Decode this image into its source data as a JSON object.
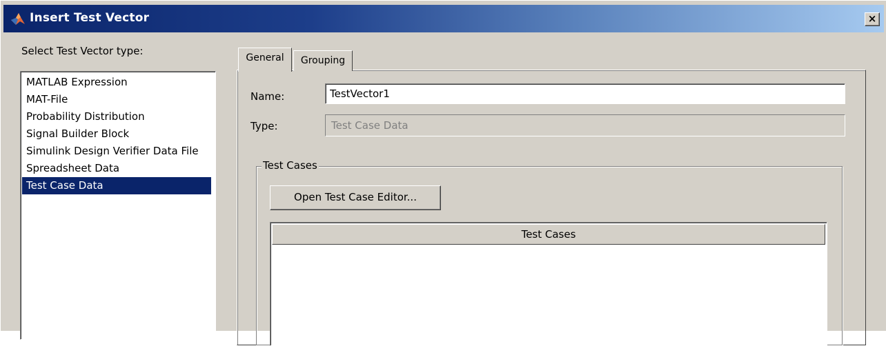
{
  "window": {
    "title": "Insert Test Vector",
    "close_label": "×"
  },
  "left": {
    "label": "Select Test Vector type:",
    "items": [
      "MATLAB Expression",
      "MAT-File",
      "Probability Distribution",
      "Signal Builder Block",
      "Simulink Design Verifier Data File",
      "Spreadsheet Data",
      "Test Case Data"
    ],
    "selected_index": 6
  },
  "tabs": [
    {
      "label": "General",
      "active": true
    },
    {
      "label": "Grouping",
      "active": false
    }
  ],
  "general": {
    "name_label": "Name:",
    "name_value": "TestVector1",
    "type_label": "Type:",
    "type_value": "Test Case Data"
  },
  "test_cases": {
    "group_title": "Test Cases",
    "open_button": "Open Test Case Editor...",
    "column_header": "Test Cases"
  },
  "colors": {
    "selection": "#0a246a",
    "face": "#d4d0c8"
  }
}
